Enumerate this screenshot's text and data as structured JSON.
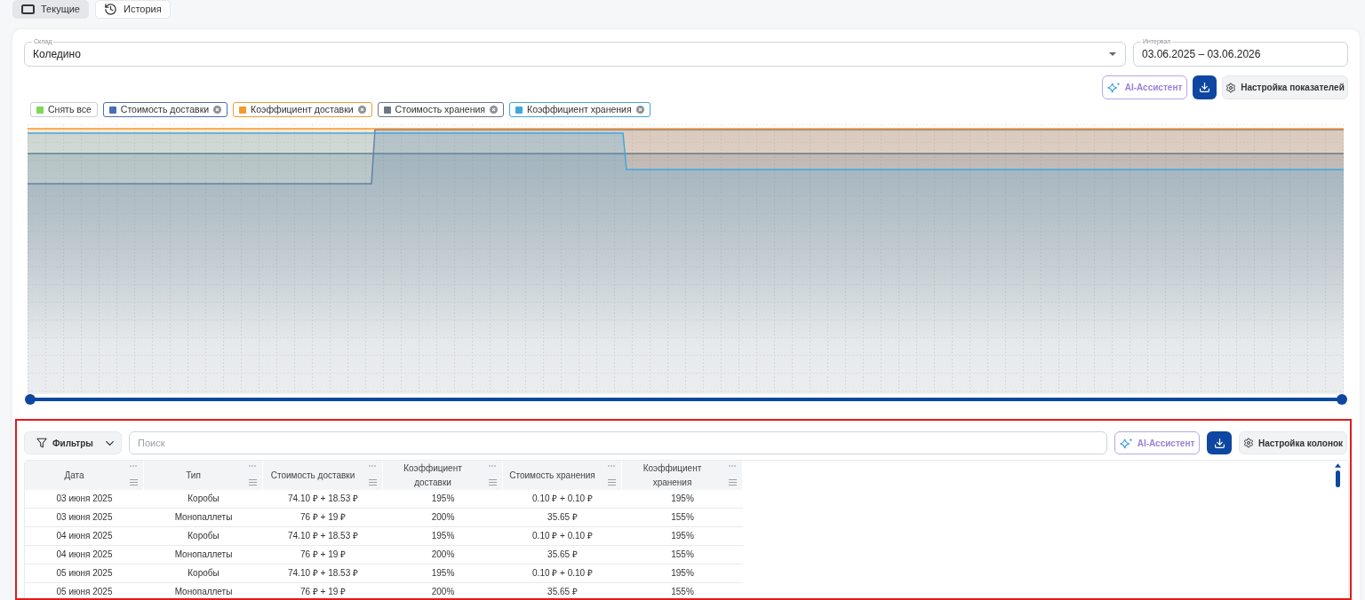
{
  "view_tabs": [
    {
      "kind": "current",
      "label": "Текущие",
      "selected": true
    },
    {
      "kind": "history",
      "label": "История",
      "selected": false
    }
  ],
  "filters": {
    "warehouse": {
      "label": "Склад",
      "value": "Коледино"
    },
    "interval": {
      "label": "Интервал",
      "value": "03.06.2025 – 03.06.2026"
    }
  },
  "chart_toolbar": {
    "ai_button": "AI-Ассистент",
    "settings_button": "Настройка показателей"
  },
  "legend": {
    "clear_all": {
      "label": "Снять все",
      "color": "#7ed957"
    },
    "items": [
      {
        "label": "Стоимость доставки",
        "color": "#4b6cb7"
      },
      {
        "label": "Коэффициент доставки",
        "color": "#f39a2f"
      },
      {
        "label": "Стоимость хранения",
        "color": "#6b7785"
      },
      {
        "label": "Коэффициент хранения",
        "color": "#3fa7e0"
      }
    ]
  },
  "range_slider": {
    "handles": [
      {
        "level": 0
      },
      {
        "level": 1
      }
    ]
  },
  "table_panel": {
    "highlighted": true,
    "filter_button": "Фильтры",
    "search": {
      "placeholder": "Поиск"
    },
    "ai_button": "AI-Ассистент",
    "settings_button": "Настройка колонок",
    "columns": [
      "Дата",
      "Тип",
      "Стоимость доставки",
      "Коэффициент доставки",
      "Стоимость хранения",
      "Коэффициент хранения"
    ],
    "rows": [
      [
        "03 июня 2025",
        "Коробы",
        "74.10 ₽ + 18.53 ₽",
        "195%",
        "0.10 ₽ + 0.10 ₽",
        "195%"
      ],
      [
        "03 июня 2025",
        "Монопаллеты",
        "76 ₽ + 19 ₽",
        "200%",
        "35.65 ₽",
        "155%"
      ],
      [
        "04 июня 2025",
        "Коробы",
        "74.10 ₽ + 18.53 ₽",
        "195%",
        "0.10 ₽ + 0.10 ₽",
        "195%"
      ],
      [
        "04 июня 2025",
        "Монопаллеты",
        "76 ₽ + 19 ₽",
        "200%",
        "35.65 ₽",
        "155%"
      ],
      [
        "05 июня 2025",
        "Коробы",
        "74.10 ₽ + 18.53 ₽",
        "195%",
        "0.10 ₽ + 0.10 ₽",
        "195%"
      ],
      [
        "05 июня 2025",
        "Монопаллеты",
        "76 ₽ + 19 ₽",
        "200%",
        "35.65 ₽",
        "155%"
      ]
    ]
  }
}
